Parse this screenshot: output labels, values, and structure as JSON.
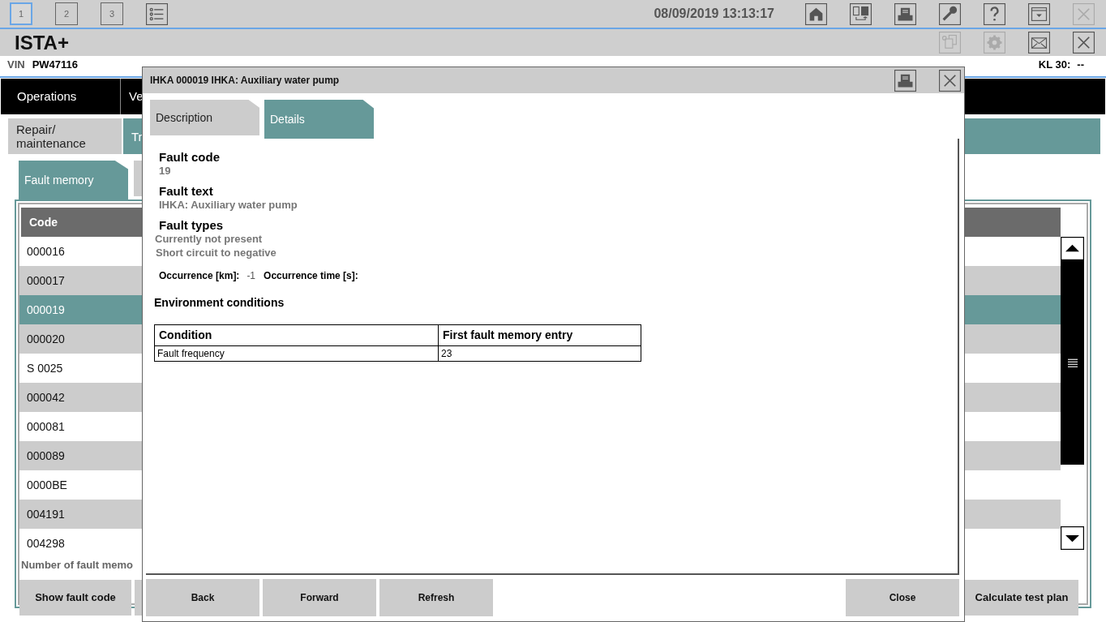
{
  "header": {
    "workspaces": [
      {
        "label": "1",
        "selected": true
      },
      {
        "label": "2",
        "selected": false
      },
      {
        "label": "3",
        "selected": false
      }
    ],
    "datetime": "08/09/2019 13:13:17"
  },
  "app_title": "ISTA+",
  "vehicle_bar": {
    "vin_label": "VIN",
    "vin": "PW47116",
    "kl30_label": "KL 30:",
    "kl30": "--"
  },
  "main_tabs": [
    {
      "label": "Operations"
    },
    {
      "label": "Ve"
    }
  ],
  "sub_tabs": [
    {
      "label": "Repair/ maintenance",
      "selected": false
    },
    {
      "label": "Tr",
      "selected": true
    }
  ],
  "fault_tabs": [
    {
      "label": "Fault memory",
      "selected": true
    },
    {
      "selected": false
    }
  ],
  "table": {
    "columns": [
      "Code"
    ],
    "rows": [
      {
        "code": "000016",
        "selected": false
      },
      {
        "code": "000017",
        "selected": false
      },
      {
        "code": "000019",
        "selected": true
      },
      {
        "code": "000020",
        "selected": false
      },
      {
        "code": "S 0025",
        "selected": false
      },
      {
        "code": "000042",
        "selected": false
      },
      {
        "code": "000081",
        "selected": false
      },
      {
        "code": "000089",
        "selected": false
      },
      {
        "code": "0000BE",
        "selected": false
      },
      {
        "code": "004191",
        "selected": false
      },
      {
        "code": "004298",
        "selected": false
      }
    ]
  },
  "footer_label": "Number of fault memo",
  "footer_buttons": [
    "Show fault code",
    "Calculate test plan"
  ],
  "dialog": {
    "title": "IHKA 000019 IHKA: Auxiliary water pump",
    "tabs": [
      {
        "label": "Description",
        "selected": false
      },
      {
        "label": "Details",
        "selected": true
      }
    ],
    "fault_code_label": "Fault code",
    "fault_code": "19",
    "fault_text_label": "Fault text",
    "fault_text": "IHKA: Auxiliary water pump",
    "fault_types_label": "Fault types",
    "fault_types": [
      "Currently not present",
      "Short circuit to negative"
    ],
    "occurrence_km_label": "Occurrence [km]:",
    "occurrence_km": "-1",
    "occurrence_time_label": "Occurrence time [s]:",
    "environment_title": "Environment conditions",
    "environment_table": {
      "columns": [
        "Condition",
        "First fault memory entry"
      ],
      "rows": [
        [
          "Fault frequency",
          "23"
        ]
      ]
    },
    "buttons_left": [
      "Back",
      "Forward",
      "Refresh"
    ],
    "buttons_right": [
      "Close"
    ]
  }
}
